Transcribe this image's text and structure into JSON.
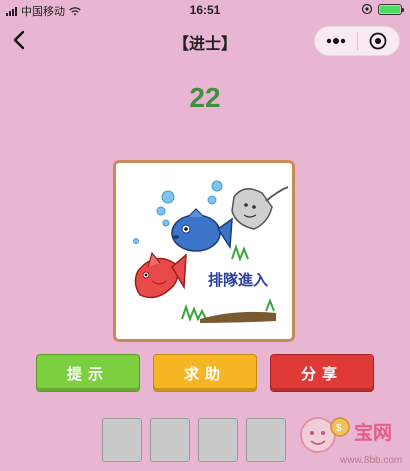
{
  "status_bar": {
    "carrier": "中国移动",
    "time": "16:51"
  },
  "nav": {
    "title": "【进士】",
    "back_icon": "chevron-left-icon",
    "more_icon": "more-dots-icon",
    "close_icon": "target-close-icon"
  },
  "level": "22",
  "puzzle": {
    "caption": "排隊進入"
  },
  "actions": {
    "hint": "提示",
    "help": "求助",
    "share": "分享"
  },
  "colors": {
    "background": "#e8b6d2",
    "level_text": "#3e8f3e",
    "hint_button": "#7ccf3e",
    "help_button": "#f6b624",
    "share_button": "#e03a37",
    "slot": "#c9c9c9"
  },
  "answer_slots": [
    "",
    "",
    "",
    ""
  ],
  "watermark": {
    "brand": "宝网",
    "url": "www.8bb.com"
  }
}
